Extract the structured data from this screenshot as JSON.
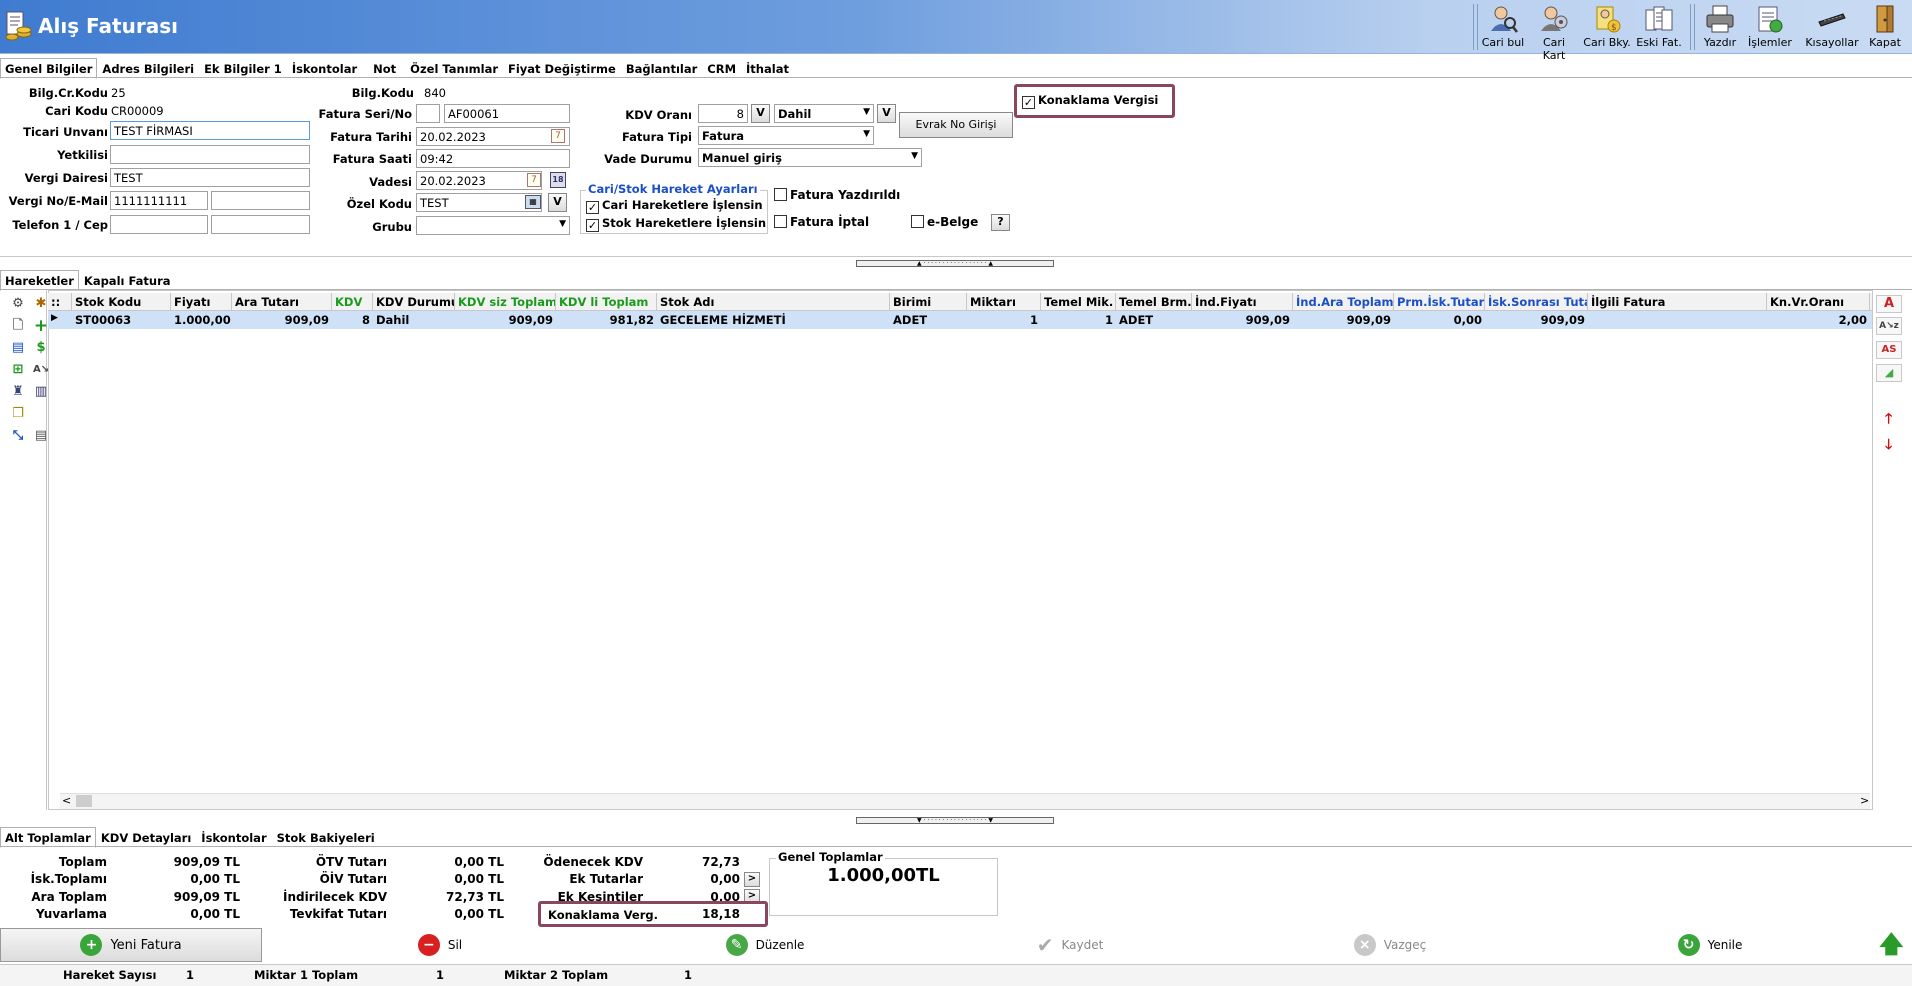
{
  "window": {
    "title": "Alış Faturası"
  },
  "toolbar": [
    {
      "label": "Cari bul",
      "icon": "person-search-icon"
    },
    {
      "label": "Cari Kart",
      "icon": "person-card-icon"
    },
    {
      "label": "Cari Bky.",
      "icon": "person-balance-icon"
    },
    {
      "label": "Eski Fat.",
      "icon": "old-invoices-icon"
    },
    {
      "label": "Yazdır",
      "icon": "printer-icon"
    },
    {
      "label": "İşlemler",
      "icon": "operations-icon"
    },
    {
      "label": "Kısayollar",
      "icon": "keyboard-icon"
    },
    {
      "label": "Kapat",
      "icon": "exit-door-icon"
    }
  ],
  "top_tabs": [
    "Genel Bilgiler",
    "Adres Bilgileri",
    "Ek Bilgiler 1",
    "İskontolar",
    "Not",
    "Özel Tanımlar",
    "Fiyat Değiştirme",
    "Bağlantılar",
    "CRM",
    "İthalat"
  ],
  "general": {
    "bilg_cr_kodu_label": "Bilg.Cr.Kodu",
    "bilg_cr_kodu": "25",
    "cari_kodu_label": "Cari Kodu",
    "cari_kodu": "CR00009",
    "ticari_unvan_label": "Ticari Unvanı",
    "ticari_unvan": "TEST FİRMASI",
    "yetkili_label": "Yetkilisi",
    "yetkili": "",
    "vergi_dairesi_label": "Vergi Dairesi",
    "vergi_dairesi": "TEST",
    "vergi_no_label": "Vergi No/E-Mail",
    "vergi_no": "1111111111",
    "email": "",
    "telefon_label": "Telefon 1 / Cep",
    "telefon": "",
    "cep": "",
    "bilg_kodu_label": "Bilg.Kodu",
    "bilg_kodu": "840",
    "fatura_seri_label": "Fatura Seri/No",
    "fatura_seri": "",
    "fatura_no": "AF00061",
    "fatura_tarihi_label": "Fatura Tarihi",
    "fatura_tarihi": "20.02.2023",
    "fatura_saati_label": "Fatura Saati",
    "fatura_saati": "09:42",
    "vadesi_label": "Vadesi",
    "vadesi": "20.02.2023",
    "ozel_kodu_label": "Özel Kodu",
    "ozel_kodu": "TEST",
    "grubu_label": "Grubu",
    "grubu": "",
    "kdv_orani_label": "KDV Oranı",
    "kdv_orani": "8",
    "kdv_dahil": "Dahil",
    "fatura_tipi_label": "Fatura Tipi",
    "fatura_tipi": "Fatura",
    "vade_durumu_label": "Vade Durumu",
    "vade_durumu": "Manuel giriş",
    "evrak_no_button": "Evrak No Girişi",
    "v_button": "V",
    "konaklama_vergisi": "Konaklama Vergisi",
    "hareket_group_title": "Cari/Stok Hareket Ayarları",
    "cari_hareket": "Cari Hareketlere İşlensin",
    "stok_hareket": "Stok Hareketlere İşlensin",
    "fatura_yazdirildi": "Fatura Yazdırıldı",
    "fatura_iptal": "Fatura İptal",
    "e_belge": "e-Belge",
    "help_button": "?"
  },
  "mid_tabs": [
    "Hareketler",
    "Kapalı Fatura"
  ],
  "grid": {
    "columns": [
      "Stok Kodu",
      "Fiyatı",
      "Ara Tutarı",
      "KDV",
      "KDV Durumu",
      "KDV siz Toplam",
      "KDV li Toplam",
      "Stok Adı",
      "Birimi",
      "Miktarı",
      "Temel Mik.",
      "Temel Brm.",
      "İnd.Fiyatı",
      "İnd.Ara Toplam",
      "Prm.İsk.Tutarı",
      "İsk.Sonrası Tutar",
      "İlgili Fatura",
      "Kn.Vr.Oranı"
    ],
    "rows": [
      [
        "ST00063",
        "1.000,00",
        "909,09",
        "8",
        "Dahil",
        "909,09",
        "981,82",
        "GECELEME HİZMETİ",
        "ADET",
        "1",
        "1",
        "ADET",
        "909,09",
        "909,09",
        "0,00",
        "909,09",
        "",
        "2,00"
      ]
    ]
  },
  "bottom_tabs": [
    "Alt Toplamlar",
    "KDV Detayları",
    "İskontolar",
    "Stok Bakiyeleri"
  ],
  "totals": {
    "toplam_label": "Toplam",
    "toplam": "909,09 TL",
    "isk_toplami_label": "İsk.Toplamı",
    "isk_toplami": "0,00 TL",
    "ara_toplam_label": "Ara Toplam",
    "ara_toplam": "909,09 TL",
    "yuvarlama_label": "Yuvarlama",
    "yuvarlama": "0,00 TL",
    "otv_label": "ÖTV Tutarı",
    "otv": "0,00 TL",
    "oiv_label": "ÖİV Tutarı",
    "oiv": "0,00 TL",
    "indirilecek_kdv_label": "İndirilecek KDV",
    "indirilecek_kdv": "72,73 TL",
    "tevkifat_label": "Tevkifat Tutarı",
    "tevkifat": "0,00 TL",
    "odenecek_kdv_label": "Ödenecek KDV",
    "odenecek_kdv": "72,73",
    "ek_tutarlar_label": "Ek Tutarlar",
    "ek_tutarlar": "0,00",
    "ek_kesintiler_label": "Ek Kesintiler",
    "ek_kesintiler": "0,00",
    "konaklama_verg_label": "Konaklama Verg.",
    "konaklama_verg": "18,18",
    "genel_toplamlar_label": "Genel Toplamlar",
    "genel_toplam": "1.000,00TL",
    "arrow": ">"
  },
  "actions": {
    "yeni_fatura": "Yeni Fatura",
    "sil": "Sil",
    "duzenle": "Düzenle",
    "kaydet": "Kaydet",
    "vazgec": "Vazgeç",
    "yenile": "Yenile"
  },
  "status": {
    "hareket_sayisi_label": "Hareket Sayısı",
    "hareket_sayisi": "1",
    "miktar1_label": "Miktar 1 Toplam",
    "miktar1": "1",
    "miktar2_label": "Miktar 2 Toplam",
    "miktar2": "1"
  }
}
